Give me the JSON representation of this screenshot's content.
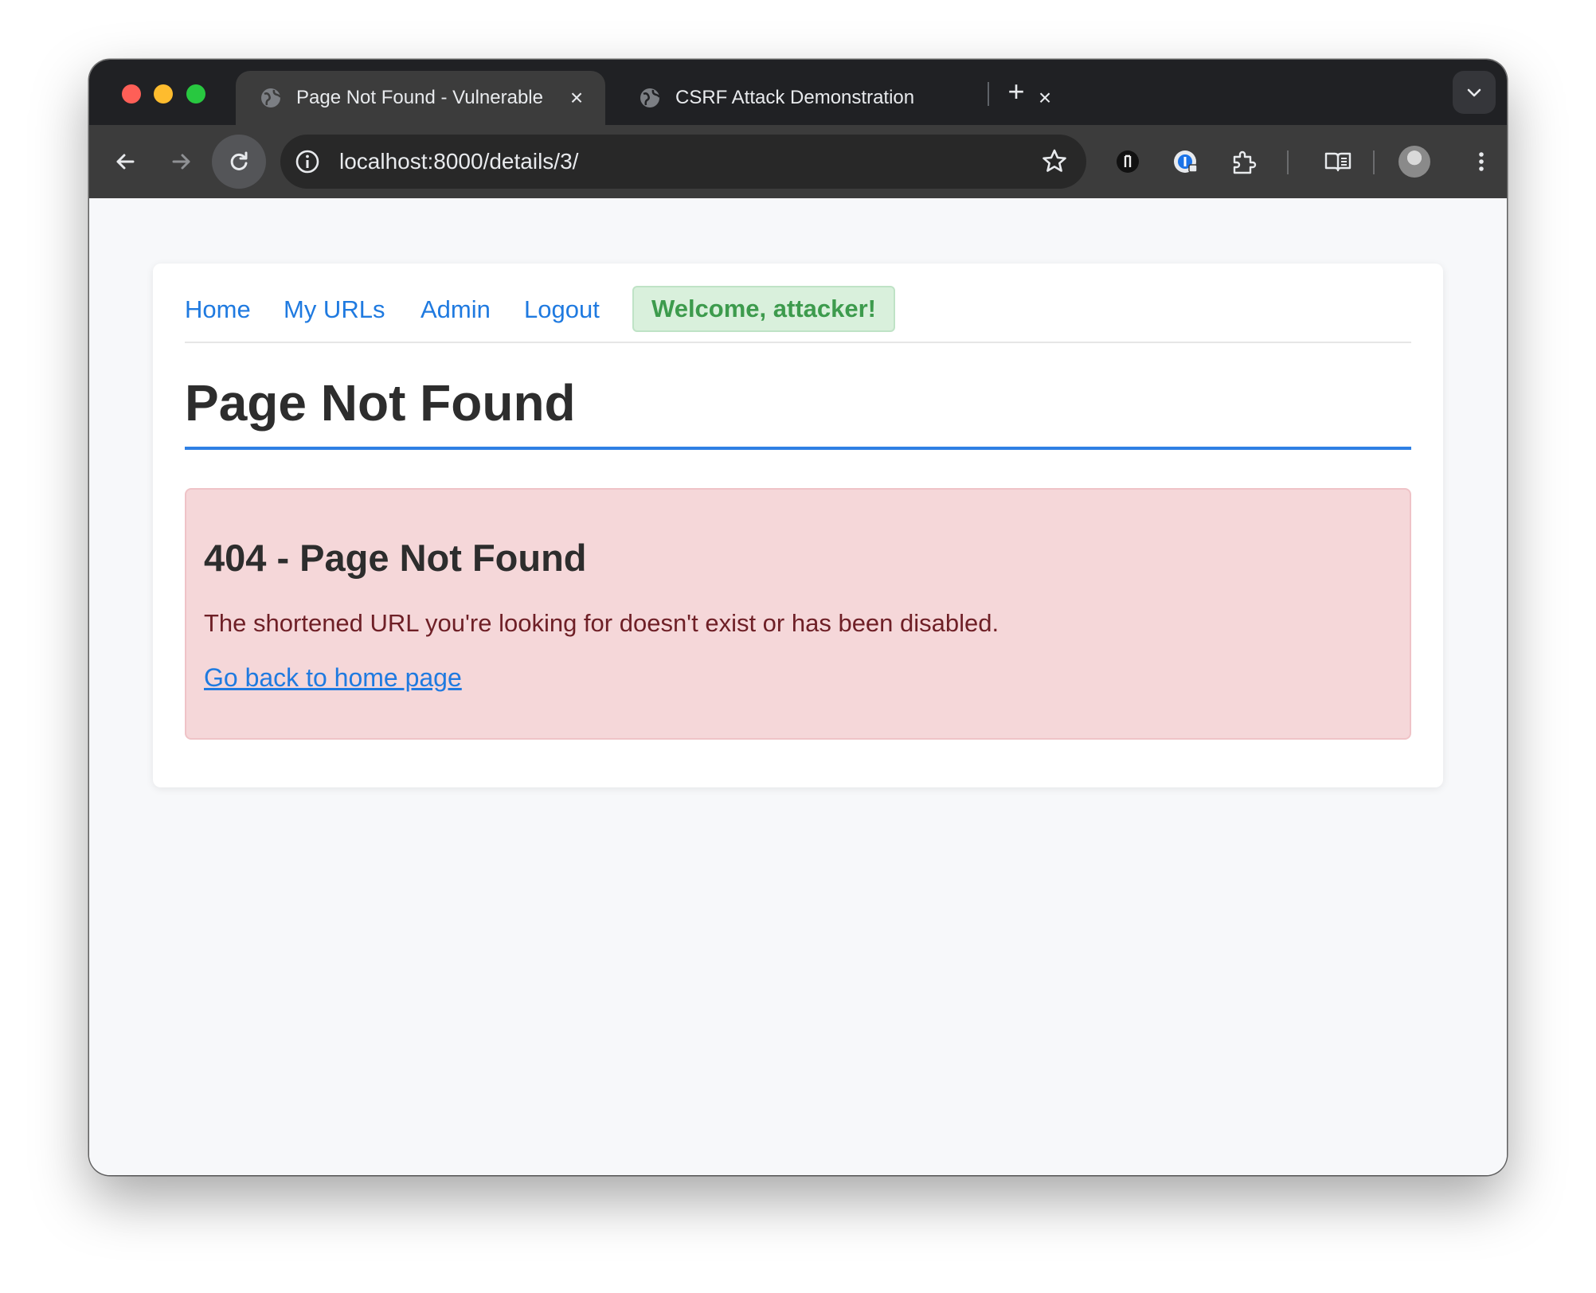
{
  "browser": {
    "tabs": [
      {
        "title": "Page Not Found - Vulnerable",
        "active": true
      },
      {
        "title": "CSRF Attack Demonstration",
        "active": false
      }
    ],
    "new_tab_label": "+",
    "close_label": "×",
    "address": "localhost:8000/details/3/"
  },
  "nav": {
    "links": [
      "Home",
      "My URLs",
      "Admin",
      "Logout"
    ],
    "welcome": "Welcome, attacker!"
  },
  "main": {
    "heading": "Page Not Found",
    "error": {
      "title": "404 - Page Not Found",
      "message": "The shortened URL you're looking for doesn't exist or has been disabled.",
      "link": "Go back to home page"
    }
  },
  "colors": {
    "link": "#1f7ae0",
    "accent_rule": "#2f80e4",
    "welcome_text": "#3d9b4d",
    "welcome_bg": "#d9f0dc",
    "alert_bg": "#f5d7d9",
    "alert_text": "#6e1f26"
  }
}
